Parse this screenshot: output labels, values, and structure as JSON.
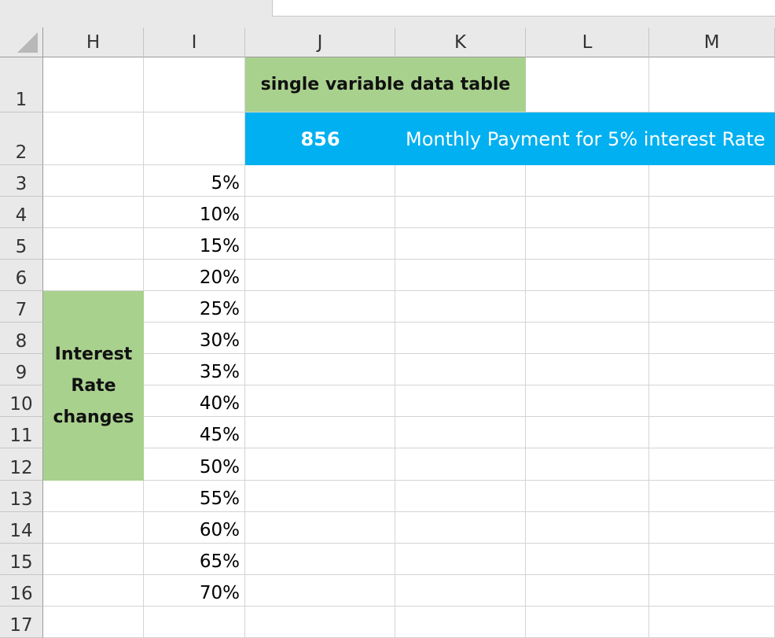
{
  "columns": [
    "H",
    "I",
    "J",
    "K",
    "L",
    "M"
  ],
  "rows": [
    "1",
    "2",
    "3",
    "4",
    "5",
    "6",
    "7",
    "8",
    "9",
    "10",
    "11",
    "12",
    "13",
    "14",
    "15",
    "16",
    "17"
  ],
  "sheet": {
    "title_cell": "single variable data table",
    "payment_value": "856",
    "payment_label": "Monthly Payment for 5% interest Rate",
    "merged_label": [
      "Interest",
      "Rate",
      "changes"
    ],
    "rates": [
      "5%",
      "10%",
      "15%",
      "20%",
      "25%",
      "30%",
      "35%",
      "40%",
      "45%",
      "50%",
      "55%",
      "60%",
      "65%",
      "70%"
    ]
  },
  "colors": {
    "green_fill": "#a9d18e",
    "blue_fill": "#00b0f0",
    "header_bg": "#e9e9e9"
  }
}
